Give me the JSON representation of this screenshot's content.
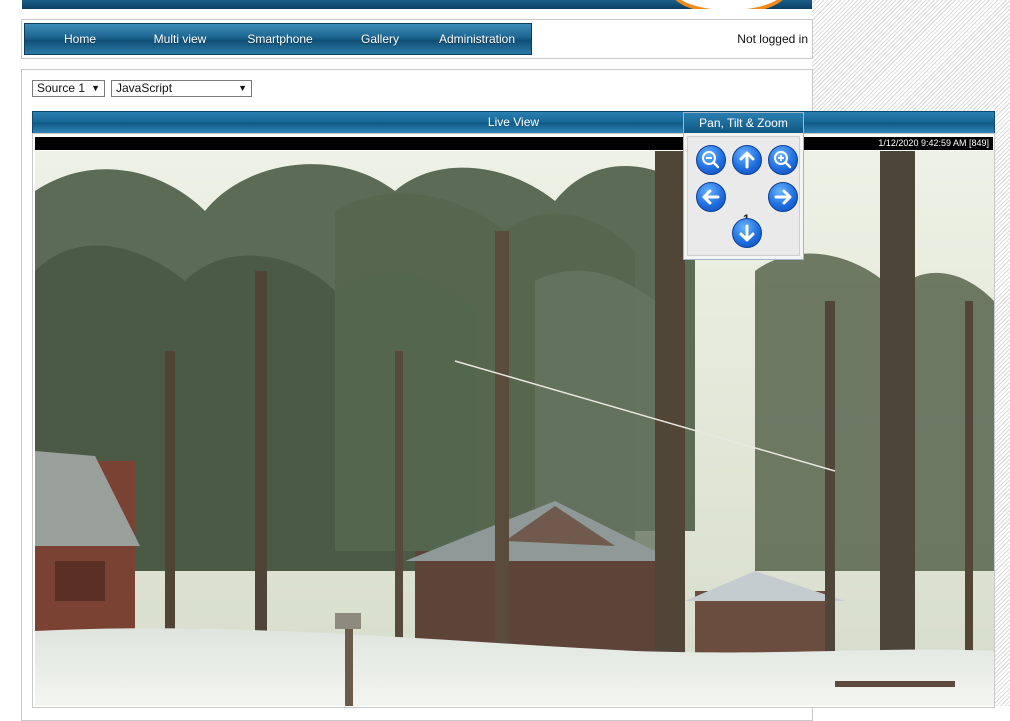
{
  "nav": {
    "items": [
      {
        "label": "Home"
      },
      {
        "label": "Multi view"
      },
      {
        "label": "Smartphone"
      },
      {
        "label": "Gallery"
      },
      {
        "label": "Administration"
      }
    ],
    "login_status": "Not logged in"
  },
  "controls": {
    "source": {
      "value": "Source 1"
    },
    "mode": {
      "value": "JavaScript"
    }
  },
  "live_view": {
    "title": "Live View",
    "timestamp": "1/12/2020 9:42:59 AM  [849]"
  },
  "ptz": {
    "title": "Pan, Tilt & Zoom",
    "level": "1",
    "buttons": [
      "zoom-out-icon",
      "arrow-up-icon",
      "zoom-in-icon",
      "arrow-left-icon",
      "arrow-right-icon",
      "arrow-down-icon"
    ]
  },
  "colors": {
    "nav_blue": "#1c6590",
    "ptz_button_blue": "#1f6fe0",
    "banner_orange": "#f08a1c"
  }
}
